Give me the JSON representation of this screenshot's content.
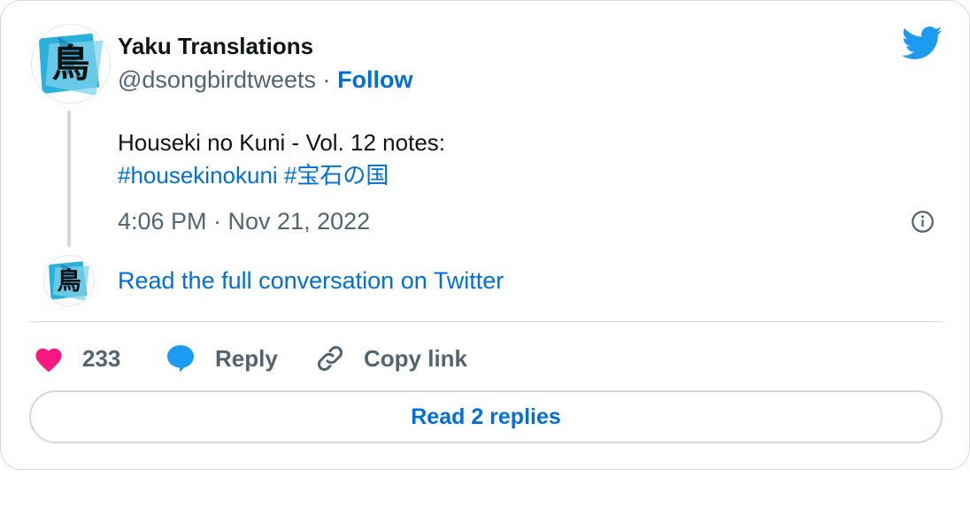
{
  "author": {
    "name": "Yaku Translations",
    "handle": "@dsongbirdtweets",
    "separator": "·",
    "follow_label": "Follow",
    "avatar_glyph": "鳥"
  },
  "tweet": {
    "text_line1": "Houseki no Kuni - Vol. 12 notes:",
    "hashtags": [
      "#housekinokuni",
      "#宝石の国"
    ],
    "timestamp": "4:06 PM · Nov 21, 2022"
  },
  "conversation": {
    "link_label": "Read the full conversation on Twitter"
  },
  "actions": {
    "like_count": "233",
    "reply_label": "Reply",
    "copy_label": "Copy link"
  },
  "replies_button": {
    "label": "Read 2 replies"
  },
  "icons": {
    "brand": "twitter-bird-icon",
    "info": "info-icon",
    "like": "heart-icon",
    "reply": "speech-bubble-icon",
    "copy": "link-icon"
  },
  "colors": {
    "link": "#006fd6",
    "twitter_blue": "#1d9bf0",
    "heart": "#f91880",
    "muted": "#536471",
    "border": "#cfd9de"
  }
}
